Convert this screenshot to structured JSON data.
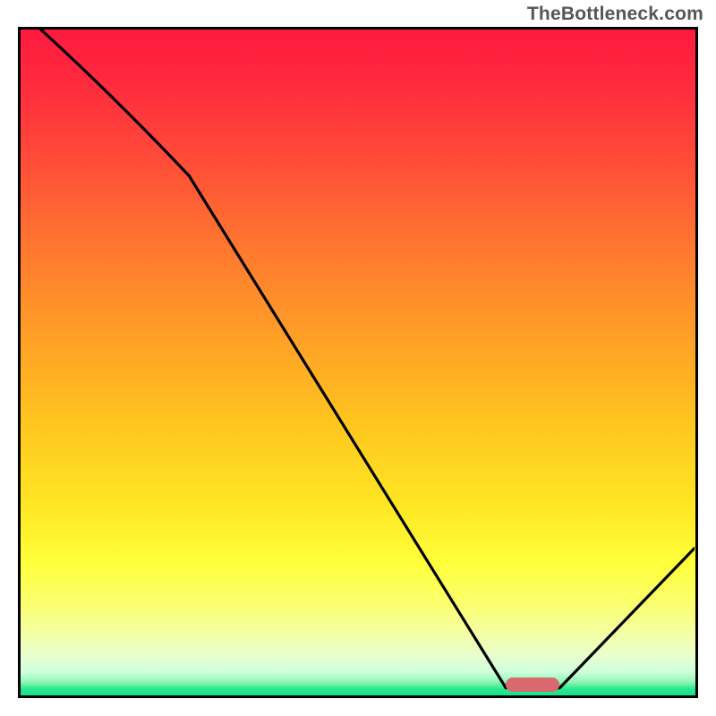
{
  "attribution": "TheBottleneck.com",
  "chart_data": {
    "type": "line",
    "title": "",
    "xlabel": "",
    "ylabel": "",
    "xlim": [
      0,
      100
    ],
    "ylim": [
      0,
      100
    ],
    "grid": false,
    "legend": false,
    "series": [
      {
        "name": "bottleneck-curve",
        "x": [
          3,
          25,
          72,
          80,
          100
        ],
        "y": [
          100,
          78,
          1,
          1,
          22
        ]
      }
    ],
    "marker": {
      "name": "optimal-range",
      "x_center": 76,
      "y": 1.5,
      "width_pct": 8,
      "color": "#d86a6f"
    },
    "background": {
      "type": "vertical-gradient",
      "stops": [
        {
          "pct": 0,
          "color": "#ff1a3f"
        },
        {
          "pct": 50,
          "color": "#ffb022"
        },
        {
          "pct": 80,
          "color": "#ffff3a"
        },
        {
          "pct": 100,
          "color": "#14e489"
        }
      ]
    }
  }
}
